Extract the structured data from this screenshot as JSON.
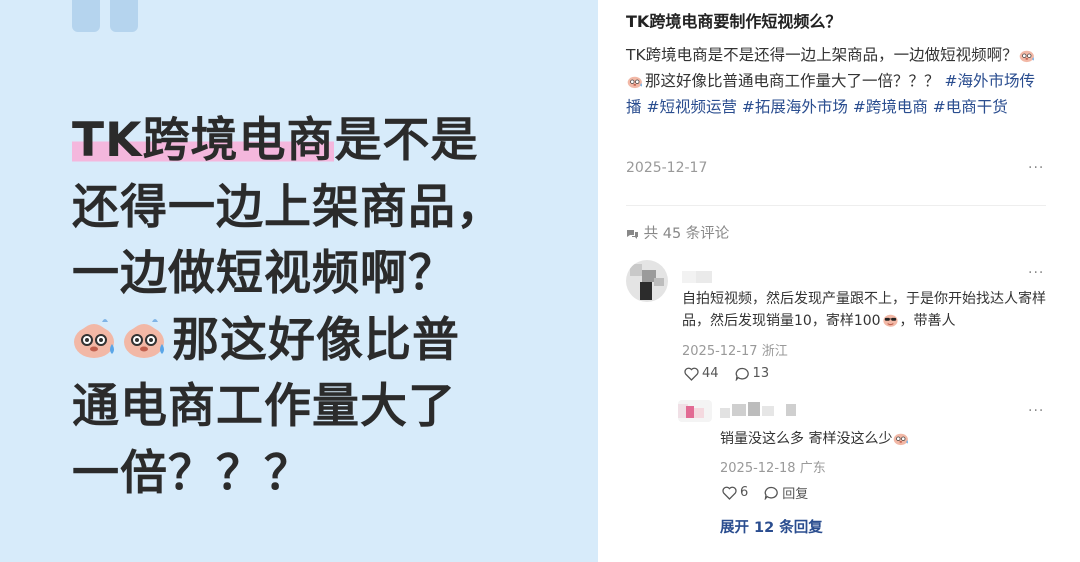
{
  "hero": {
    "line1_highlight": "TK跨境电商",
    "line1_rest": "是不是",
    "line2": "还得一边上架商品，",
    "line3": "一边做短视频啊？",
    "line4": "那这好像比普",
    "line5": "通电商工作量大了",
    "line6": "一倍？？？"
  },
  "post": {
    "title": "TK跨境电商要制作短视频么？",
    "body_part1": "TK跨境电商是不是还得一边上架商品，一边做短视频啊？",
    "body_part2": "那这好像比普通电商工作量大了一倍？？？",
    "tags": [
      "#海外市场传播",
      "#短视频运营",
      "#拓展海外市场",
      "#跨境电商",
      "#电商干货"
    ],
    "date": "2025-12-17",
    "more": "···"
  },
  "comments_header": {
    "count_text": "共 45 条评论"
  },
  "comments": [
    {
      "text_part1": "自拍短视频，然后发现产量跟不上，于是你开始找达人寄样品，然后发现销量10，寄样100",
      "text_part2": "，带善人",
      "date": "2025-12-17",
      "location": "浙江",
      "likes": "44",
      "replies": "13",
      "more": "···"
    },
    {
      "text": "销量没这么多 寄样没这么少",
      "date": "2025-12-18",
      "location": "广东",
      "likes": "6",
      "reply_label": "回复",
      "more": "···"
    }
  ],
  "expand_label": "展开 12 条回复",
  "icons": {
    "like": "heart-outline-icon",
    "comment": "speech-bubble-icon",
    "comments_header": "comments-icon",
    "emoji_sweat": "sweat-face-emoji",
    "emoji_cool": "sunglasses-face-emoji"
  },
  "colors": {
    "hero_background": "#d7ebfa",
    "highlight": "#f4b7dd",
    "tag_link": "#2a4d8f",
    "muted": "#999999"
  }
}
